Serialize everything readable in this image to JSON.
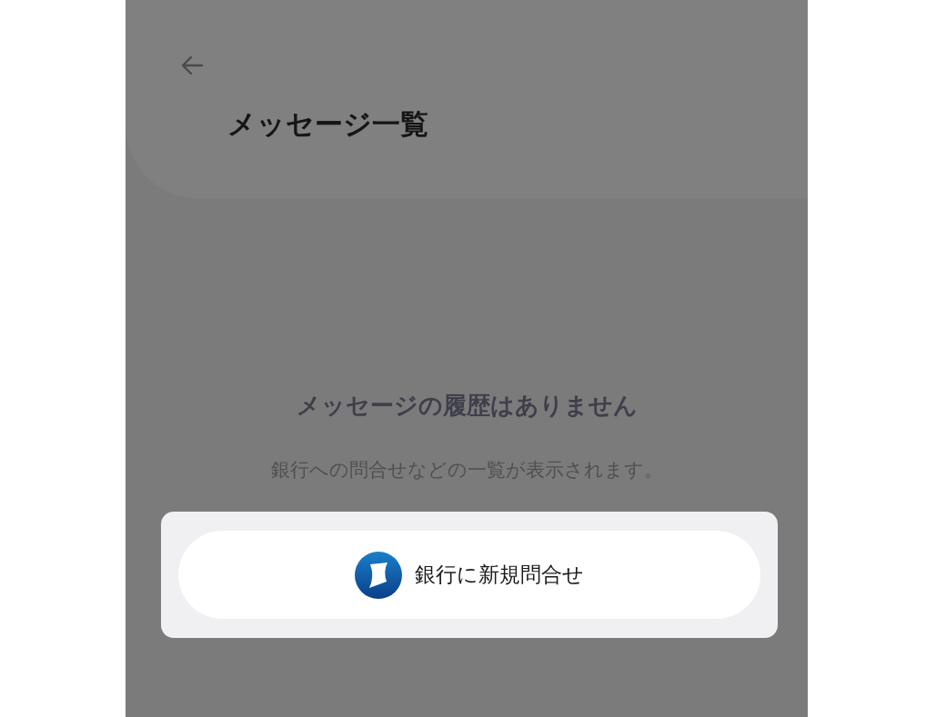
{
  "header": {
    "title": "メッセージ一覧"
  },
  "empty_state": {
    "title": "メッセージの履歴はありません",
    "description": "銀行への問合せなどの一覧が表示されます。"
  },
  "action": {
    "label": "銀行に新規問合せ"
  }
}
